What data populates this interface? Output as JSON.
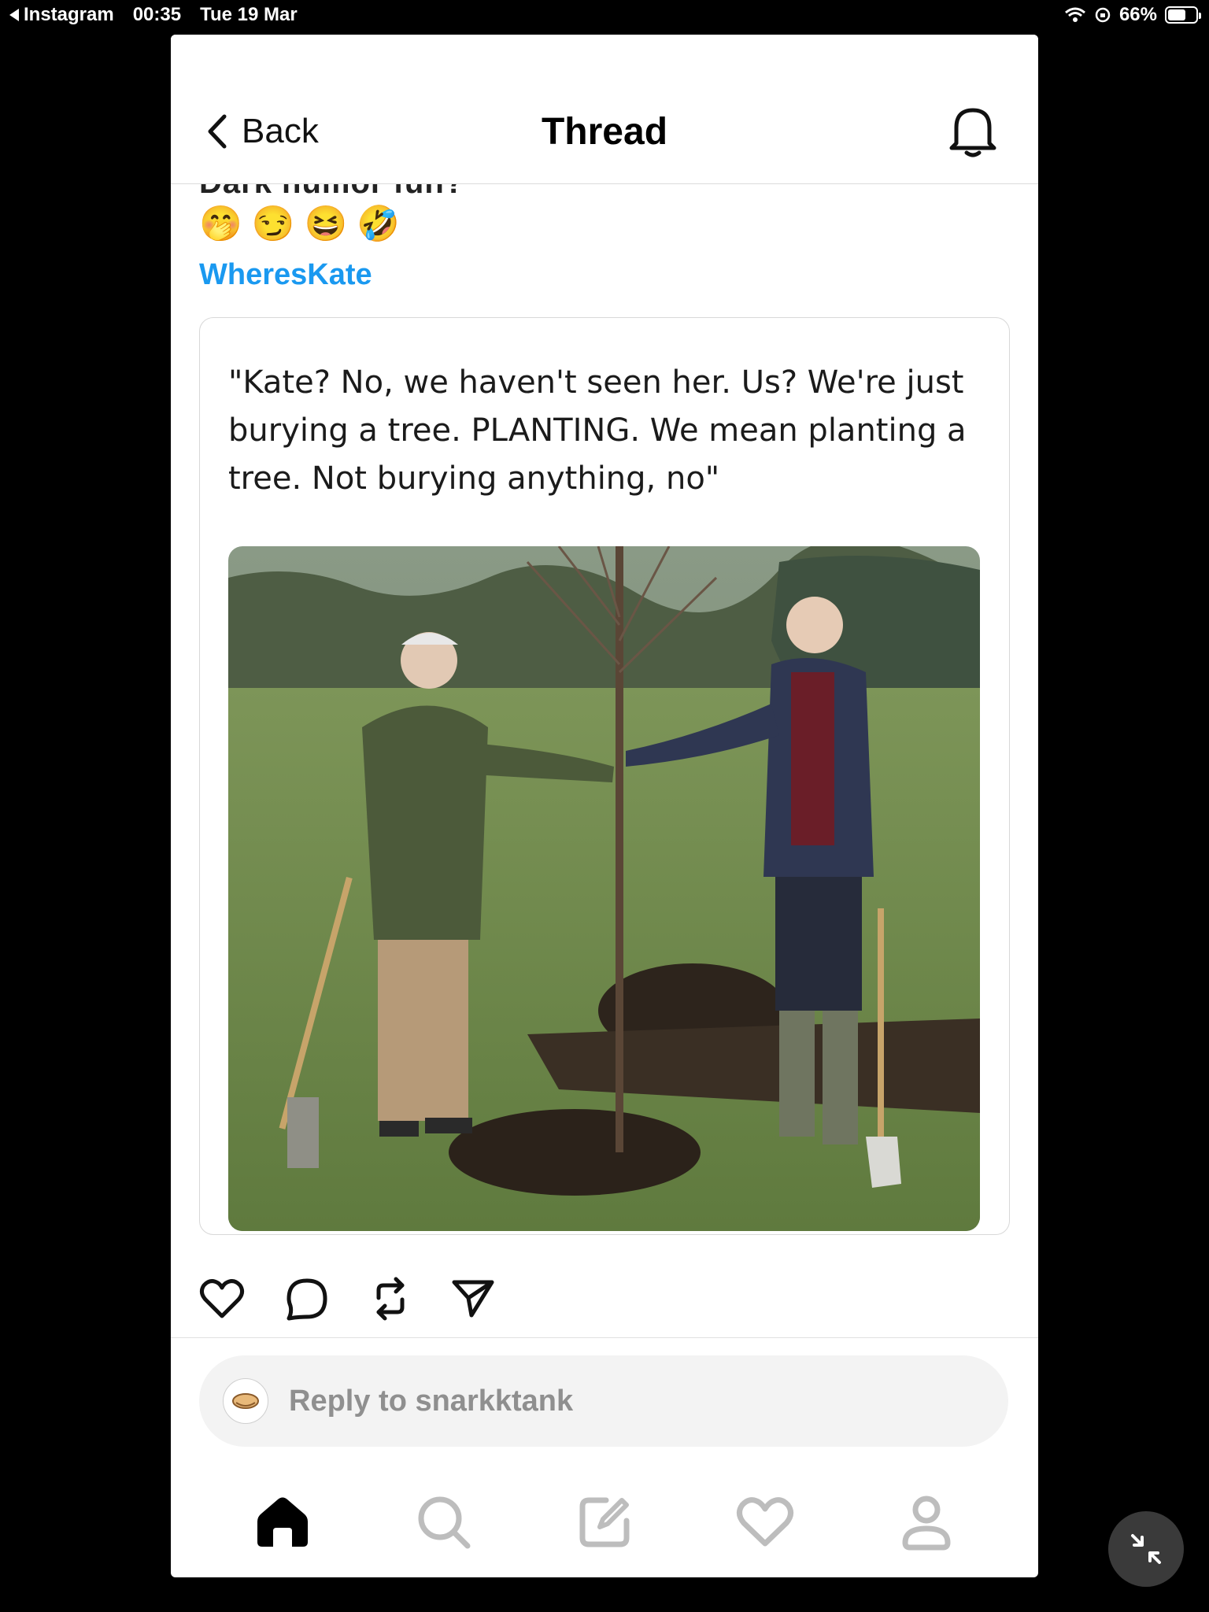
{
  "status_bar": {
    "back_app": "Instagram",
    "time": "00:35",
    "date": "Tue 19 Mar",
    "battery": "66%",
    "battery_level": 0.66
  },
  "header": {
    "back_label": "Back",
    "title": "Thread"
  },
  "post": {
    "clipped_line": "Dark humor fun?",
    "emojis": [
      "🤭",
      "😏",
      "😆",
      "🤣"
    ],
    "hashtag": "WheresKate",
    "quote_text": "\"Kate? No, we haven't seen her. Us? We're just burying a tree. PLANTING. We mean planting a tree. Not burying anything, no\""
  },
  "reply": {
    "placeholder": "Reply to snarkktank"
  },
  "icons": {
    "back": "chevron-left-icon",
    "bell": "bell-icon",
    "like": "heart-icon",
    "comment": "comment-icon",
    "repost": "repost-icon",
    "share": "send-icon",
    "home": "home-icon",
    "search": "search-icon",
    "compose": "compose-icon",
    "activity": "heart-icon",
    "profile": "profile-icon",
    "minimize": "minimize-icon"
  },
  "colors": {
    "hashtag": "#1a99f0",
    "background": "#000000",
    "card": "#ffffff"
  }
}
